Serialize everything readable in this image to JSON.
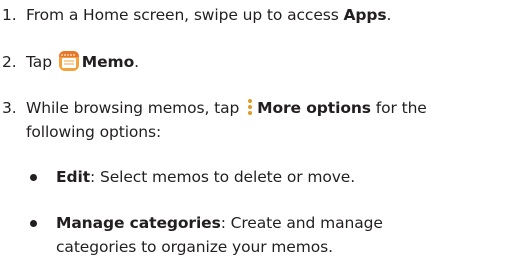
{
  "steps": [
    {
      "number": "1.",
      "text_before": "From a Home screen, swipe up to access ",
      "bold": "Apps",
      "text_after": "."
    },
    {
      "number": "2.",
      "text_before": "Tap ",
      "icon": "memo-app-icon",
      "bold": "Memo",
      "text_after": "."
    },
    {
      "number": "3.",
      "text_before": "While browsing memos, tap ",
      "icon": "more-options-icon",
      "bold": "More options",
      "text_after": " for the",
      "line2": "following options:"
    }
  ],
  "bullets": [
    {
      "term": "Edit",
      "text": ": Select memos to delete or move."
    },
    {
      "term": "Manage categories",
      "text": ": Create and manage",
      "line2": "categories to organize your memos."
    }
  ],
  "colors": {
    "text": "#231f20",
    "memo_icon_body": "#f4a23c",
    "memo_icon_top": "#e8772a",
    "memo_icon_paper": "#ffffff"
  }
}
